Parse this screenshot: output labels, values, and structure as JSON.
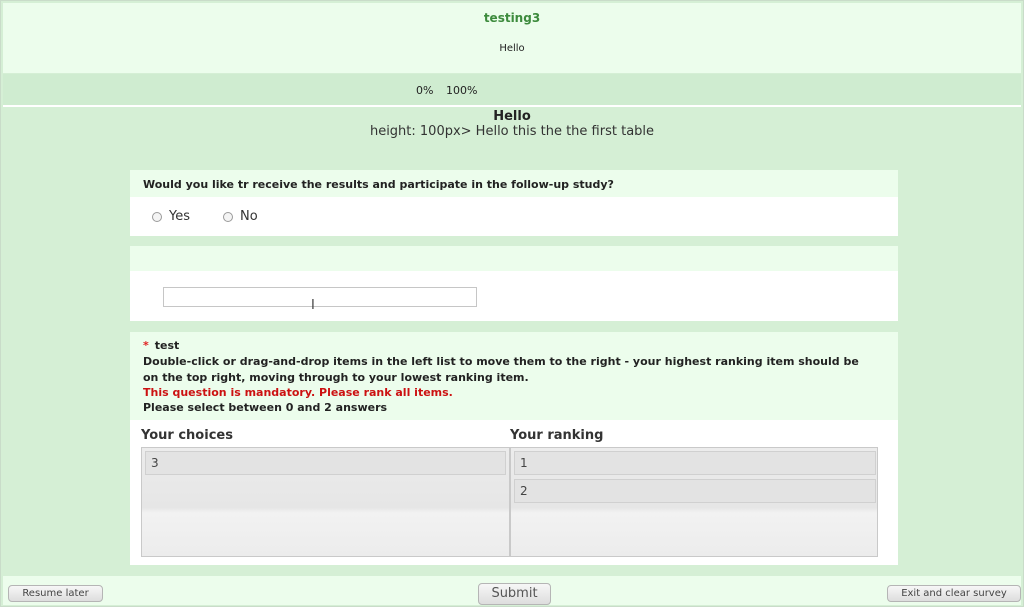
{
  "survey": {
    "title": "testing3",
    "description": "Hello"
  },
  "progress": {
    "start_label": "0%",
    "end_label": "100%",
    "value_percent": 0
  },
  "group": {
    "title": "Hello",
    "description": "height: 100px> Hello this the the first table"
  },
  "question1": {
    "text": "Would you like tr receive the results and participate in the follow-up study?",
    "options": [
      "Yes",
      "No"
    ]
  },
  "question2": {
    "text": "",
    "input_value": ""
  },
  "question3": {
    "mandatory_marker": "*",
    "title": "test",
    "help_line1": "Double-click or drag-and-drop items in the left list to move them to the right - your highest ranking item should be",
    "help_line2": "on the top right, moving through to your lowest ranking item.",
    "mandatory_text": "This question is mandatory. Please rank all items.",
    "selection_hint": "Please select between 0 and 2 answers",
    "choices_header": "Your choices",
    "ranking_header": "Your ranking",
    "choices": [
      "3"
    ],
    "ranking": [
      "1",
      "2"
    ]
  },
  "buttons": {
    "resume": "Resume later",
    "submit": "Submit",
    "exit": "Exit and clear survey"
  },
  "colors": {
    "page_background": "#d5efd5",
    "panel_light": "#ecfdec",
    "title_green": "#3d8b3d",
    "mandatory_red": "#cc1111"
  },
  "icons": {
    "text_cursor": "I-beam-cursor-icon"
  }
}
